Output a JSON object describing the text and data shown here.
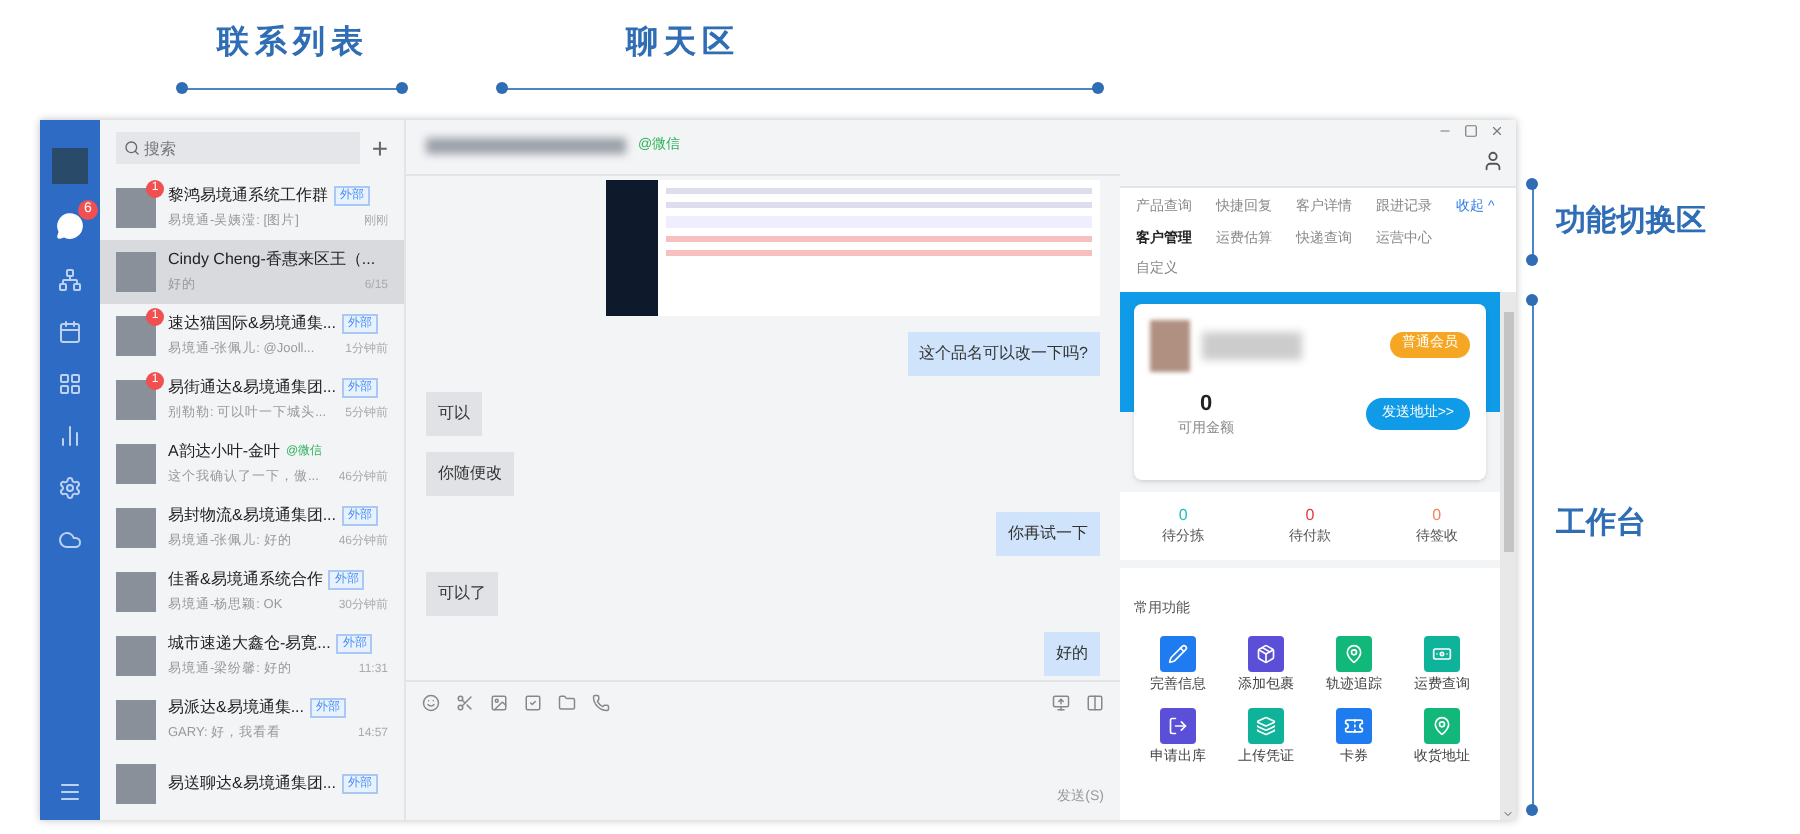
{
  "annotations": {
    "contacts_label": "联系列表",
    "chat_label": "聊天区",
    "switch_label": "功能切换区",
    "workbench_label": "工作台"
  },
  "sidebar": {
    "chat_badge": "6"
  },
  "search": {
    "placeholder": "搜索",
    "add": "+"
  },
  "contacts": [
    {
      "name": "黎鸿易境通系统工作群",
      "tag": "外部",
      "preview": "易境通-吴姨滢: [图片]",
      "time": "刚刚",
      "badge": "1",
      "selected": false
    },
    {
      "name": "Cindy Cheng-香惠来区王（...",
      "preview": "好的",
      "time": "6/15",
      "selected": true
    },
    {
      "name": "速达猫国际&易境通集...",
      "tag": "外部",
      "preview": "易境通-张佩儿: @Jooll...",
      "time": "1分钟前",
      "badge": "1",
      "selected": false
    },
    {
      "name": "易街通达&易境通集团...",
      "tag": "外部",
      "preview": "别勒勒: 可以叶一下城头...",
      "time": "5分钟前",
      "badge": "1",
      "selected": false
    },
    {
      "name": "A韵达小叶-金叶",
      "wechat": "@微信",
      "preview": "这个我确认了一下，傲...",
      "time": "46分钟前",
      "selected": false
    },
    {
      "name": "易封物流&易境通集团...",
      "tag": "外部",
      "preview": "易境通-张佩儿: 好的",
      "time": "46分钟前",
      "selected": false
    },
    {
      "name": "佳番&易境通系统合作",
      "tag": "外部",
      "preview": "易境通-杨思颖: OK",
      "time": "30分钟前",
      "selected": false
    },
    {
      "name": "城市速递大鑫仓-易寛...",
      "tag": "外部",
      "preview": "易境通-梁纷馨: 好的",
      "time": "11:31",
      "selected": false
    },
    {
      "name": "易派达&易境通集...",
      "tag": "外部",
      "preview": "GARY: 好，我看看",
      "time": "14:57",
      "selected": false
    },
    {
      "name": "易送聊达&易境通集团...",
      "tag": "外部",
      "selected": false
    }
  ],
  "chat": {
    "header_tag": "@微信",
    "messages": [
      {
        "kind": "image"
      },
      {
        "kind": "sent",
        "text": "这个品名可以改一下吗?"
      },
      {
        "kind": "received",
        "text": "可以"
      },
      {
        "kind": "received",
        "text": "你随便改"
      },
      {
        "kind": "sent",
        "text": "你再试一下"
      },
      {
        "kind": "received",
        "text": "可以了"
      },
      {
        "kind": "sent",
        "text": "好的"
      }
    ],
    "send": "发送(S)"
  },
  "panel": {
    "tabs": [
      [
        {
          "label": "产品查询",
          "selected": false
        },
        {
          "label": "快捷回复",
          "selected": false
        },
        {
          "label": "客户详情",
          "selected": false
        },
        {
          "label": "跟进记录",
          "selected": false
        }
      ],
      [
        {
          "label": "客户管理",
          "selected": true
        },
        {
          "label": "运费估算",
          "selected": false
        },
        {
          "label": "快递查询",
          "selected": false
        },
        {
          "label": "运营中心",
          "selected": false
        }
      ],
      [
        {
          "label": "自定义",
          "selected": false
        }
      ]
    ],
    "collapse": "收起 ^",
    "member": "普通会员",
    "balance": "0",
    "balance_label": "可用金额",
    "send_address": "发送地址>>",
    "stats": [
      {
        "value": "0",
        "label": "待分拣",
        "color": "#19c2b8"
      },
      {
        "value": "0",
        "label": "待付款",
        "color": "#e83a3a"
      },
      {
        "value": "0",
        "label": "待签收",
        "color": "#f2835a"
      }
    ],
    "functions_title": "常用功能",
    "functions": [
      {
        "label": "完善信息",
        "color": "#1f7cf0",
        "kind": "edit"
      },
      {
        "label": "添加包裹",
        "color": "#5a4fd6",
        "kind": "box"
      },
      {
        "label": "轨迹追踪",
        "color": "#11b87a",
        "kind": "track"
      },
      {
        "label": "运费查询",
        "color": "#0fb39a",
        "kind": "money"
      },
      {
        "label": "申请出库",
        "color": "#5a4fd6",
        "kind": "out"
      },
      {
        "label": "上传凭证",
        "color": "#0fb39a",
        "kind": "layers"
      },
      {
        "label": "卡券",
        "color": "#1f7cf0",
        "kind": "card"
      },
      {
        "label": "收货地址",
        "color": "#11b87a",
        "kind": "pin"
      }
    ]
  }
}
